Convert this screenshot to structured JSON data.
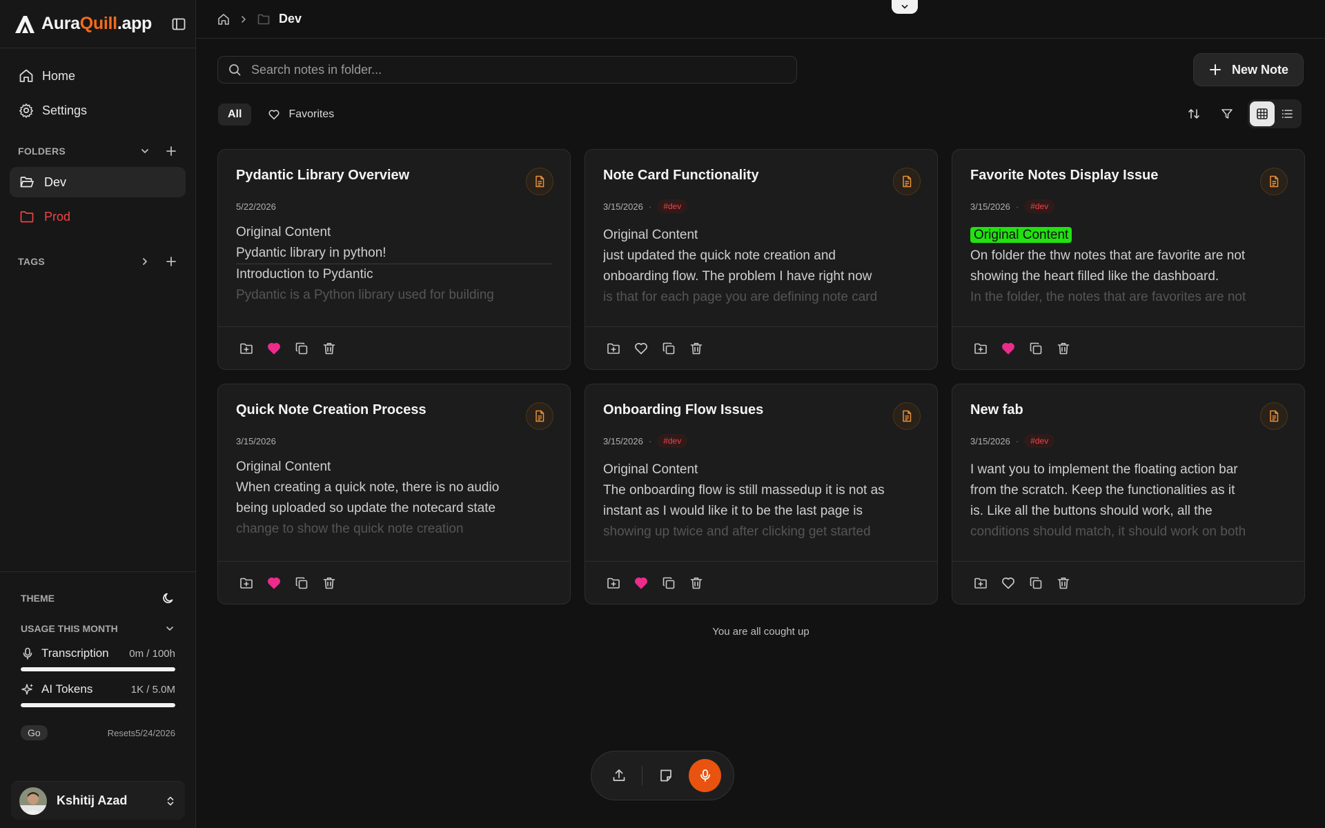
{
  "app": {
    "brand_prefix": "Aura",
    "brand_accent": "Quill",
    "brand_suffix": ".app",
    "accent_color": "#f26b1d"
  },
  "sidebar": {
    "nav": [
      {
        "label": "Home",
        "icon": "home-icon"
      },
      {
        "label": "Settings",
        "icon": "gear-icon"
      }
    ],
    "folders_label": "FOLDERS",
    "folders": [
      {
        "label": "Dev",
        "active": true
      },
      {
        "label": "Prod",
        "color": "#ef4444"
      }
    ],
    "tags_label": "TAGS",
    "theme_label": "THEME",
    "usage_label": "USAGE THIS MONTH",
    "usage": [
      {
        "label": "Transcription",
        "amount": "0m / 100h",
        "fraction": 1.0
      },
      {
        "label": "AI Tokens",
        "amount": "1K / 5.0M",
        "fraction": 1.0
      }
    ],
    "plan": "Go",
    "resets": "Resets5/24/2026",
    "user": {
      "name": "Kshitij Azad"
    }
  },
  "topbar": {
    "breadcrumb_title": "Dev"
  },
  "toolbar": {
    "search_placeholder": "Search notes in folder...",
    "new_note_label": "New Note",
    "filter_all": "All",
    "filter_favorites": "Favorites"
  },
  "cards": [
    {
      "title": "Pydantic Library Overview",
      "date": "5/22/2026",
      "tag": "",
      "lines": [
        "Original Content",
        "Pydantic library in python!",
        "Introduction to Pydantic",
        "Pydantic is a Python library used for building"
      ],
      "favorite": true
    },
    {
      "title": "Note Card Functionality",
      "date": "3/15/2026",
      "tag": "#dev",
      "lines": [
        "Original Content",
        "just updated the quick note creation and",
        "onboarding flow. The problem I have right now",
        "is that for each page you are defining note card"
      ],
      "favorite": false
    },
    {
      "title": "Favorite Notes Display Issue",
      "date": "3/15/2026",
      "tag": "#dev",
      "lines": [
        "Original Content",
        "On folder the thw notes that are favorite are not",
        "showing the heart filled like the dashboard.",
        "In the folder, the notes that are favorites are not"
      ],
      "favorite": true
    },
    {
      "title": "Quick Note Creation Process",
      "date": "3/15/2026",
      "tag": "",
      "lines": [
        "Original Content",
        "When creating a quick note, there is no audio",
        "being uploaded so update the notecard state",
        "change to show the quick note creation"
      ],
      "favorite": true
    },
    {
      "title": "Onboarding Flow Issues",
      "date": "3/15/2026",
      "tag": "#dev",
      "lines": [
        "Original Content",
        "The onboarding flow is still massedup it is not as",
        "instant as I would like it to be the last page is",
        "showing up twice and after clicking get started"
      ],
      "favorite": true
    },
    {
      "title": "New fab",
      "date": "3/15/2026",
      "tag": "#dev",
      "lines": [
        "I want you to implement the floating action bar",
        "from the scratch. Keep the functionalities as it",
        "is. Like all the buttons should work, all the",
        "conditions should match, it should work on both"
      ],
      "favorite": false
    }
  ],
  "footer_text": "You are all cought up",
  "colors": {
    "favorite": "#ec2b8c",
    "mic": "#e8540f",
    "highlight": "#22e012"
  }
}
